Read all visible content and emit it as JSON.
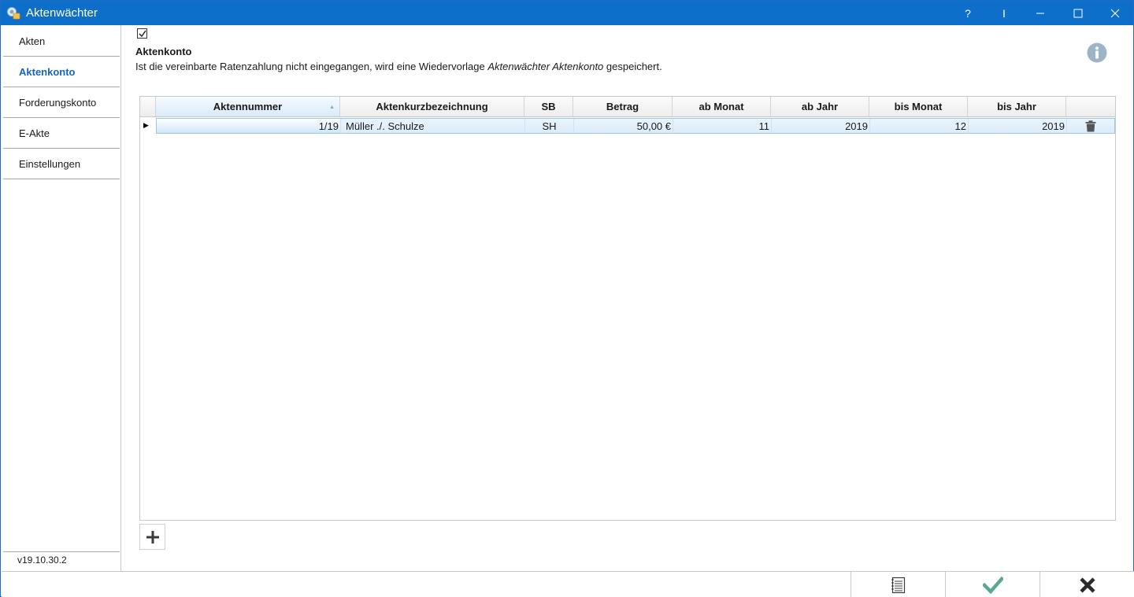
{
  "window": {
    "title": "Aktenwächter"
  },
  "titlebar": {
    "help_label": "?",
    "cursor_label": "I"
  },
  "sidebar": {
    "items": [
      {
        "label": "Akten"
      },
      {
        "label": "Aktenkonto"
      },
      {
        "label": "Forderungskonto"
      },
      {
        "label": "E-Akte"
      },
      {
        "label": "Einstellungen"
      }
    ],
    "active_index": 1,
    "version": "v19.10.30.2"
  },
  "section": {
    "checked": true,
    "title": "Aktenkonto",
    "desc_prefix": "Ist die vereinbarte Ratenzahlung nicht eingegangen, wird eine Wiedervorlage ",
    "desc_italic": "Aktenwächter Aktenkonto",
    "desc_suffix": " gespeichert."
  },
  "table": {
    "columns": [
      "Aktennummer",
      "Aktenkurzbezeichnung",
      "SB",
      "Betrag",
      "ab Monat",
      "ab Jahr",
      "bis Monat",
      "bis Jahr"
    ],
    "rows": [
      [
        "1/19",
        "Müller ./. Schulze",
        "SH",
        "50,00 €",
        "11",
        "2019",
        "12",
        "2019"
      ]
    ]
  },
  "colors": {
    "titlebar": "#0d6fc9",
    "accent": "#1565c0",
    "ok_check": "#5aa894"
  },
  "icons": {
    "info": "info-icon",
    "add": "plus-icon",
    "delete": "trash-icon",
    "list": "list-icon",
    "ok": "checkmark-icon",
    "cancel": "close-icon"
  }
}
